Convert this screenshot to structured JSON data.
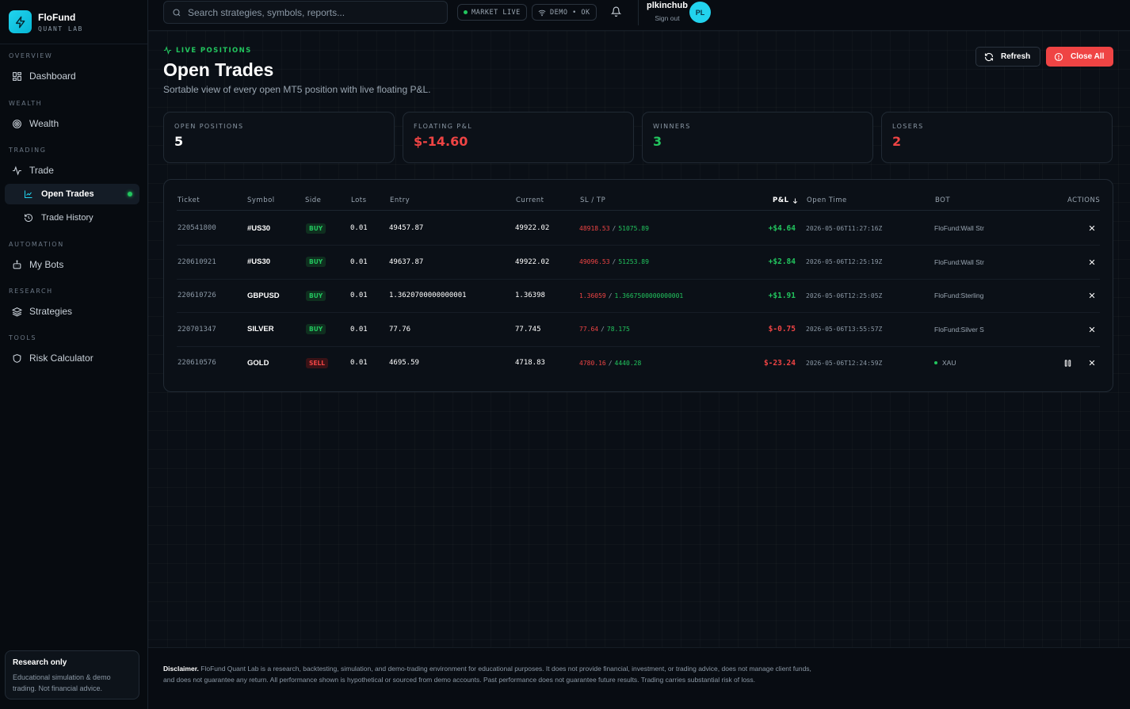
{
  "brand": {
    "name": "FloFund",
    "subtitle": "QUANT LAB"
  },
  "sidebar": {
    "sections": [
      {
        "label": "OVERVIEW"
      },
      {
        "label": "WEALTH"
      },
      {
        "label": "TRADING"
      },
      {
        "label": "AUTOMATION"
      },
      {
        "label": "RESEARCH"
      },
      {
        "label": "TOOLS"
      }
    ],
    "items": {
      "dashboard": "Dashboard",
      "wealth": "Wealth",
      "trade": "Trade",
      "open_trades": "Open Trades",
      "trade_history": "Trade History",
      "my_bots": "My Bots",
      "strategies": "Strategies",
      "risk_calculator": "Risk Calculator"
    },
    "card": {
      "title": "Research only",
      "text": "Educational simulation & demo trading. Not financial advice."
    }
  },
  "topbar": {
    "search_placeholder": "Search strategies, symbols, reports...",
    "market_status": "MARKET LIVE",
    "connection_status": "DEMO • OK",
    "user_name": "plkinchub",
    "sign_out": "Sign out",
    "avatar_initials": "PL"
  },
  "page": {
    "eyebrow": "LIVE POSITIONS",
    "title": "Open Trades",
    "subtitle": "Sortable view of every open MT5 position with live floating P&L.",
    "refresh_label": "Refresh",
    "close_all_label": "Close All"
  },
  "stats": [
    {
      "label": "OPEN POSITIONS",
      "value": "5",
      "color": "#ffffff"
    },
    {
      "label": "FLOATING P&L",
      "value": "$-14.60",
      "color": "#ef4444"
    },
    {
      "label": "WINNERS",
      "value": "3",
      "color": "#22c55e"
    },
    {
      "label": "LOSERS",
      "value": "2",
      "color": "#ef4444"
    }
  ],
  "table": {
    "headers": {
      "ticket": "Ticket",
      "symbol": "Symbol",
      "side": "Side",
      "lots": "Lots",
      "entry": "Entry",
      "current": "Current",
      "sltp": "SL / TP",
      "pnl": "P&L",
      "open_time": "Open Time",
      "bot": "BOT",
      "actions": "ACTIONS"
    },
    "rows": [
      {
        "ticket": "220541800",
        "symbol": "#US30",
        "side": "BUY",
        "lots": "0.01",
        "entry": "49457.87",
        "current": "49922.02",
        "sl": "48918.53",
        "tp": "51075.89",
        "pnl": "+$4.64",
        "open_time": "2026-05-06T11:27:16Z",
        "bot": "FloFund:Wall Str"
      },
      {
        "ticket": "220610921",
        "symbol": "#US30",
        "side": "BUY",
        "lots": "0.01",
        "entry": "49637.87",
        "current": "49922.02",
        "sl": "49096.53",
        "tp": "51253.89",
        "pnl": "+$2.84",
        "open_time": "2026-05-06T12:25:19Z",
        "bot": "FloFund:Wall Str"
      },
      {
        "ticket": "220610726",
        "symbol": "GBPUSD",
        "side": "BUY",
        "lots": "0.01",
        "entry": "1.3620700000000001",
        "current": "1.36398",
        "sl": "1.36059",
        "tp": "1.3667500000000001",
        "pnl": "+$1.91",
        "open_time": "2026-05-06T12:25:05Z",
        "bot": "FloFund:Sterling"
      },
      {
        "ticket": "220701347",
        "symbol": "SILVER",
        "side": "BUY",
        "lots": "0.01",
        "entry": "77.76",
        "current": "77.745",
        "sl": "77.64",
        "tp": "78.175",
        "pnl": "$-0.75",
        "open_time": "2026-05-06T13:55:57Z",
        "bot": "FloFund:Silver S"
      },
      {
        "ticket": "220610576",
        "symbol": "GOLD",
        "side": "SELL",
        "lots": "0.01",
        "entry": "4695.59",
        "current": "4718.83",
        "sl": "4780.16",
        "tp": "4440.28",
        "pnl": "$-23.24",
        "open_time": "2026-05-06T12:24:59Z",
        "bot": "XAU"
      }
    ]
  },
  "footer": {
    "disclaimer_label": "Disclaimer.",
    "disclaimer_text": "FloFund Quant Lab is a research, backtesting, simulation, and demo-trading environment for educational purposes. It does not provide financial, investment, or trading advice, does not manage client funds, and does not guarantee any return. All performance shown is hypothetical or sourced from demo accounts. Past performance does not guarantee future results. Trading carries substantial risk of loss."
  },
  "colors": {
    "accent": "#22d3ee",
    "positive": "#22c55e",
    "negative": "#ef4444",
    "background": "#0a0f16"
  }
}
